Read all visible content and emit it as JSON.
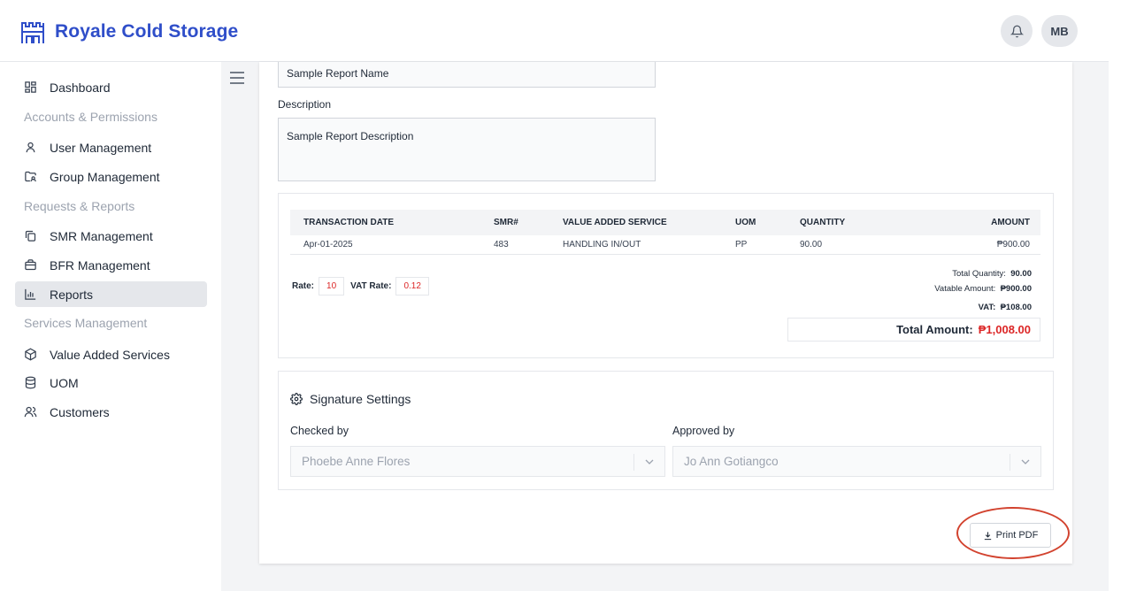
{
  "app": {
    "title": "Royale Cold Storage"
  },
  "header": {
    "avatar_initials": "MB",
    "bell_icon": "bell-icon"
  },
  "sidebar": {
    "items": [
      {
        "label": "Dashboard",
        "icon": "dashboard-icon"
      },
      {
        "section": "Accounts & Permissions"
      },
      {
        "label": "User Management",
        "icon": "user-icon"
      },
      {
        "label": "Group Management",
        "icon": "folder-users-icon"
      },
      {
        "section": "Requests & Reports"
      },
      {
        "label": "SMR Management",
        "icon": "copy-icon"
      },
      {
        "label": "BFR Management",
        "icon": "briefcase-icon"
      },
      {
        "label": "Reports",
        "icon": "bar-chart-icon",
        "active": true
      },
      {
        "section": "Services Management"
      },
      {
        "label": "Value Added Services",
        "icon": "package-icon"
      },
      {
        "label": "UOM",
        "icon": "database-icon"
      },
      {
        "label": "Customers",
        "icon": "users-icon"
      }
    ]
  },
  "form": {
    "report_name_value": "Sample Report Name",
    "description_label": "Description",
    "description_value": "Sample Report Description"
  },
  "transactions": {
    "columns": [
      "TRANSACTION DATE",
      "SMR#",
      "VALUE ADDED SERVICE",
      "UOM",
      "QUANTITY",
      "AMOUNT"
    ],
    "rows": [
      {
        "date": "Apr-01-2025",
        "smr": "483",
        "service": "HANDLING IN/OUT",
        "uom": "PP",
        "quantity": "90.00",
        "amount": "₱900.00"
      }
    ],
    "rate_label": "Rate:",
    "rate_value": "10",
    "vat_rate_label": "VAT Rate:",
    "vat_rate_value": "0.12"
  },
  "totals": {
    "total_quantity_label": "Total Quantity:",
    "total_quantity_value": "90.00",
    "vatable_amount_label": "Vatable Amount:",
    "vatable_amount_value": "₱900.00",
    "vat_label": "VAT:",
    "vat_value": "₱108.00",
    "total_amount_label": "Total Amount:",
    "total_amount_value": "₱1,008.00"
  },
  "signature": {
    "title": "Signature Settings",
    "checked_by_label": "Checked by",
    "checked_by_value": "Phoebe Anne Flores",
    "approved_by_label": "Approved by",
    "approved_by_value": "Jo Ann Gotiangco"
  },
  "actions": {
    "print_pdf_label": "Print PDF"
  },
  "colors": {
    "brand": "#2f4ec9",
    "accent_red": "#dc2626",
    "annotation": "#d2432f"
  }
}
